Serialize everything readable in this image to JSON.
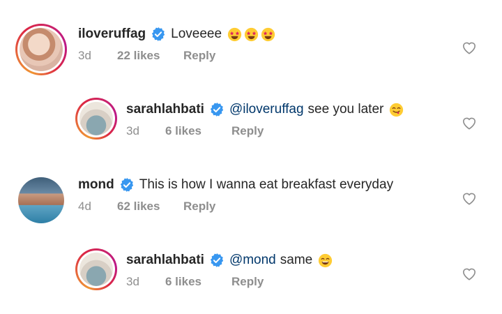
{
  "comments": [
    {
      "username": "iloveruffag",
      "verified": true,
      "text": "Loveeee",
      "emojis": [
        "star-struck-emoji",
        "star-struck-emoji",
        "star-struck-emoji"
      ],
      "time": "3d",
      "likes": "22 likes",
      "reply": "Reply"
    },
    {
      "username": "sarahlahbati",
      "verified": true,
      "mention": "@iloveruffag",
      "text": "see you later",
      "emojis": [
        "face-savoring-food-emoji"
      ],
      "time": "3d",
      "likes": "6 likes",
      "reply": "Reply"
    },
    {
      "username": "mond",
      "verified": true,
      "text": "This is how I wanna eat breakfast everyday",
      "time": "4d",
      "likes": "62 likes",
      "reply": "Reply"
    },
    {
      "username": "sarahlahbati",
      "verified": true,
      "mention": "@mond",
      "text": "same",
      "emojis": [
        "grinning-squinting-emoji"
      ],
      "time": "3d",
      "likes": "6 likes",
      "reply": "Reply"
    }
  ],
  "colors": {
    "text": "#262626",
    "meta": "#8e8e8e",
    "mention": "#00376b",
    "verified": "#3897f0"
  },
  "icons": {
    "verified": "verified-badge-icon",
    "like": "heart-outline-icon"
  }
}
